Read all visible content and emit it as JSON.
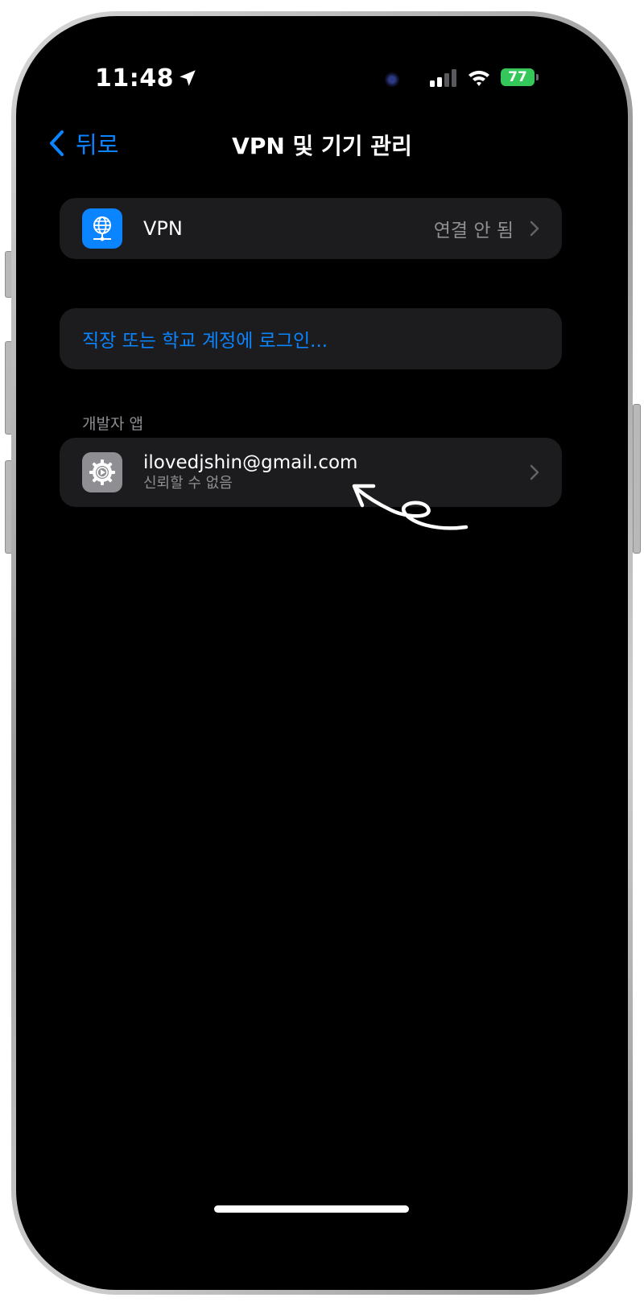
{
  "status_bar": {
    "time": "11:48",
    "battery": "77",
    "icons": [
      "location-arrow-icon",
      "signal-bars-icon",
      "wifi-icon",
      "battery-charging-icon"
    ],
    "battery_color": "#34c759"
  },
  "nav": {
    "back_label": "뒤로",
    "title": "VPN 및 기기 관리"
  },
  "vpn_row": {
    "icon": "globe-network-icon",
    "icon_color": "#0a84ff",
    "label": "VPN",
    "value": "연결 안 됨"
  },
  "login_row": {
    "label": "직장 또는 학교 계정에 로그인..."
  },
  "developer_section": {
    "header": "개발자 앱",
    "item": {
      "icon": "gear-icon",
      "title": "ilovedjshin@gmail.com",
      "subtitle": "신뢰할 수 없음"
    }
  },
  "colors": {
    "accent": "#0a84ff",
    "background": "#000000",
    "cell_background": "#1c1c1e",
    "secondary_text": "#8e8e93"
  }
}
